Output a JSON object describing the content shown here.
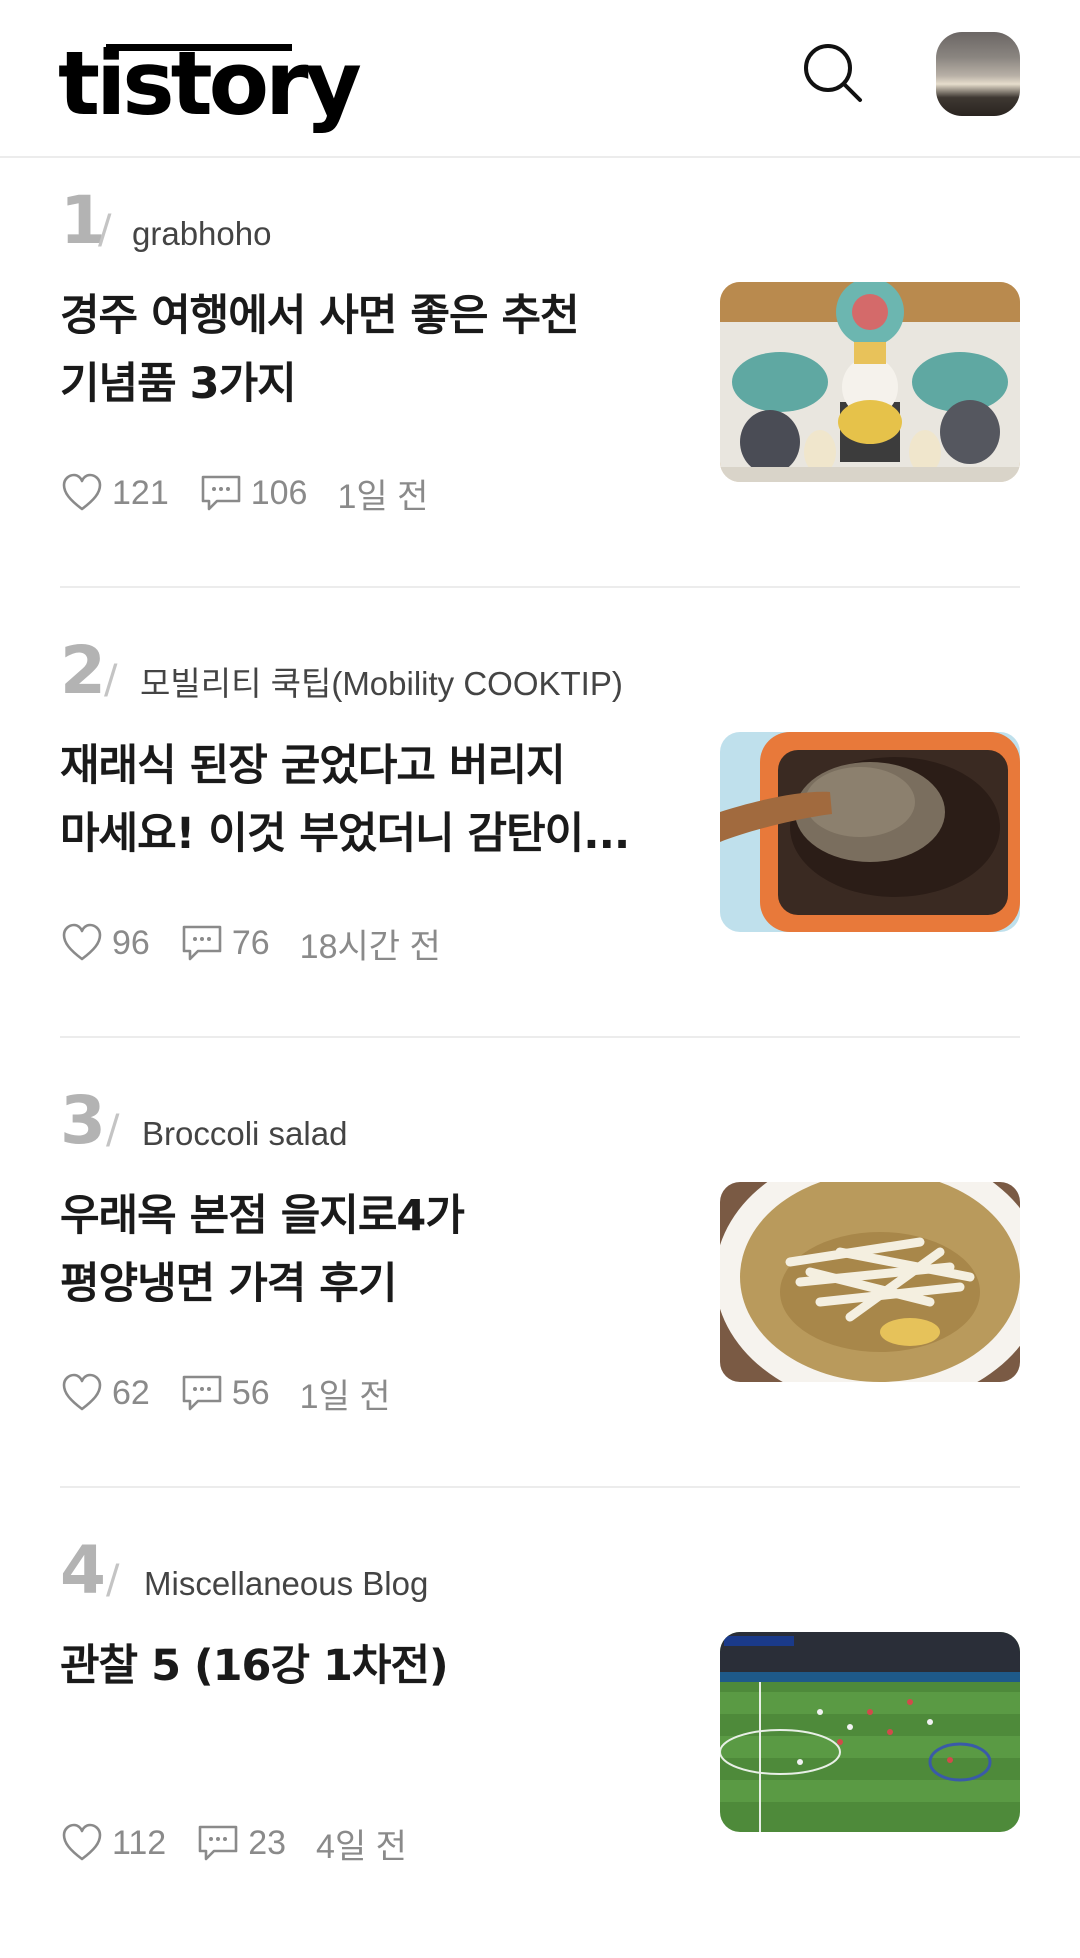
{
  "header": {
    "logo_text": "tistory",
    "search_icon": "search-icon",
    "avatar_icon": "profile-avatar"
  },
  "posts": [
    {
      "rank": "1",
      "blog": "grabhoho",
      "title_lines": [
        "경주 여행에서 사면 좋은 추천",
        "기념품 3가지"
      ],
      "likes": "121",
      "comments": "106",
      "time": "1일 전",
      "thumb_alt": "souvenir figurines"
    },
    {
      "rank": "2",
      "blog": "모빌리티 쿡팁(Mobility COOKTIP)",
      "title_lines": [
        "재래식 된장 굳었다고 버리지",
        "마세요! 이것 부었더니 감탄이..."
      ],
      "likes": "96",
      "comments": "76",
      "time": "18시간 전",
      "thumb_alt": "soybean paste in orange container"
    },
    {
      "rank": "3",
      "blog": "Broccoli salad",
      "title_lines": [
        "우래옥 본점 을지로4가",
        "평양냉면 가격 후기"
      ],
      "likes": "62",
      "comments": "56",
      "time": "1일 전",
      "thumb_alt": "pyongyang cold noodles"
    },
    {
      "rank": "4",
      "blog": "Miscellaneous Blog",
      "title_lines": [
        "관찰 5 (16강 1차전)"
      ],
      "likes": "112",
      "comments": "23",
      "time": "4일 전",
      "thumb_alt": "soccer match broadcast"
    }
  ],
  "icons": {
    "like": "heart-icon",
    "comment": "comment-icon"
  },
  "colors": {
    "rank": "#b3b3b3",
    "meta": "#8a8a8a",
    "divider": "#ececec"
  }
}
